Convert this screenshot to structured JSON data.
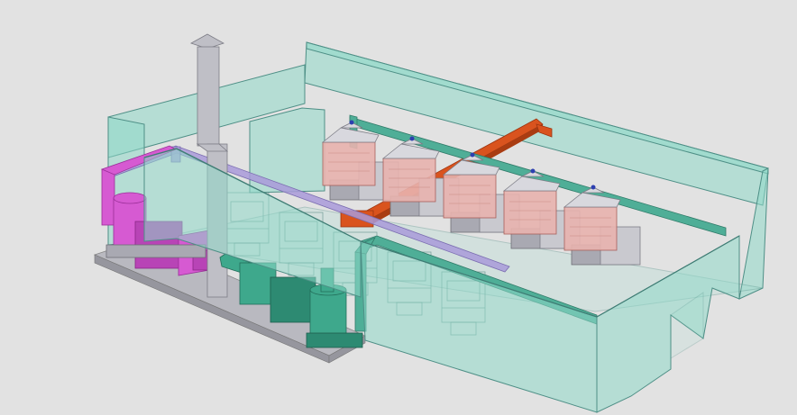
{
  "scene": {
    "background": "#e2e2e2",
    "colors": {
      "enclosure_fill": "#8fd8c8",
      "enclosure_edge": "#4e8f86",
      "machine_body": "#c9c9cf",
      "machine_dark": "#a9a9b2",
      "hood_fill": "#e8b2ae",
      "hood_top": "#d8d8de",
      "duct_green": "#4fae97",
      "duct_purple": "#a99ad9",
      "duct_orange": "#d9531e",
      "magenta_unit": "#d65ad2",
      "teal_unit": "#3ea88c",
      "stack": "#bfbfc6",
      "skid": "#b9b9c0"
    },
    "machine_count": 5,
    "ghost_machine_count": 5,
    "ghost_duct_count": 3
  }
}
